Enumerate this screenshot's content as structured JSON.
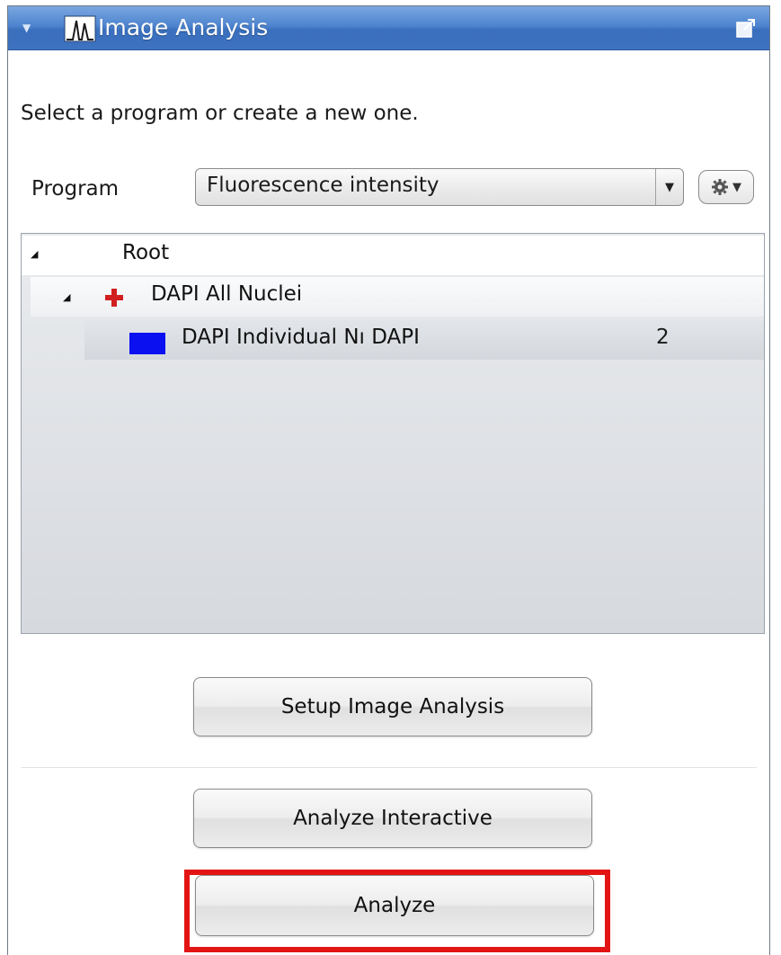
{
  "window": {
    "title": "Image Analysis",
    "accent_color": "#3d72c0"
  },
  "instruction": "Select a program or create a new one.",
  "program": {
    "label": "Program",
    "selected": "Fluorescence intensity"
  },
  "tree": {
    "root_label": "Root",
    "items": [
      {
        "label": "DAPI All Nuclei",
        "icon": "red-plus-icon"
      },
      {
        "label": "DAPI Individual Nı DAPI",
        "icon": "blue-swatch",
        "count": "2",
        "color": "#0a10f0"
      }
    ]
  },
  "buttons": {
    "setup": "Setup Image Analysis",
    "interactive": "Analyze Interactive",
    "analyze": "Analyze"
  },
  "highlight_color": "#e31414"
}
